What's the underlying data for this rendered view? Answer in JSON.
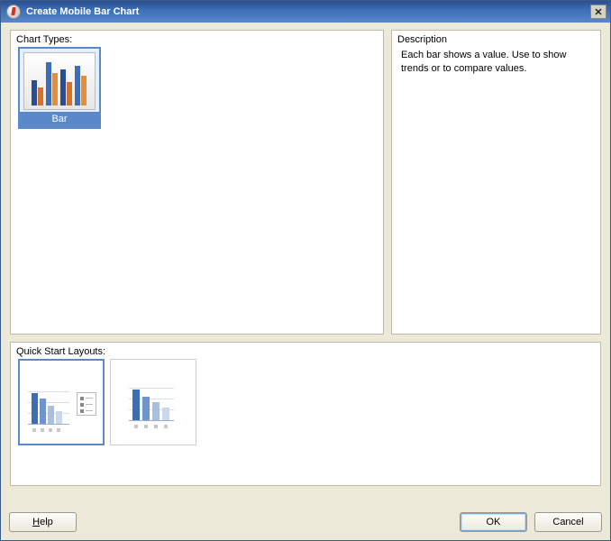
{
  "window": {
    "title": "Create Mobile Bar Chart"
  },
  "chartTypes": {
    "label": "Chart Types:",
    "items": [
      {
        "label": "Bar",
        "selected": true
      }
    ]
  },
  "description": {
    "label": "Description",
    "text": "Each bar shows a value. Use to show trends or to compare values."
  },
  "quickStart": {
    "label": "Quick Start Layouts:"
  },
  "buttons": {
    "help": "Help",
    "ok": "OK",
    "cancel": "Cancel"
  }
}
